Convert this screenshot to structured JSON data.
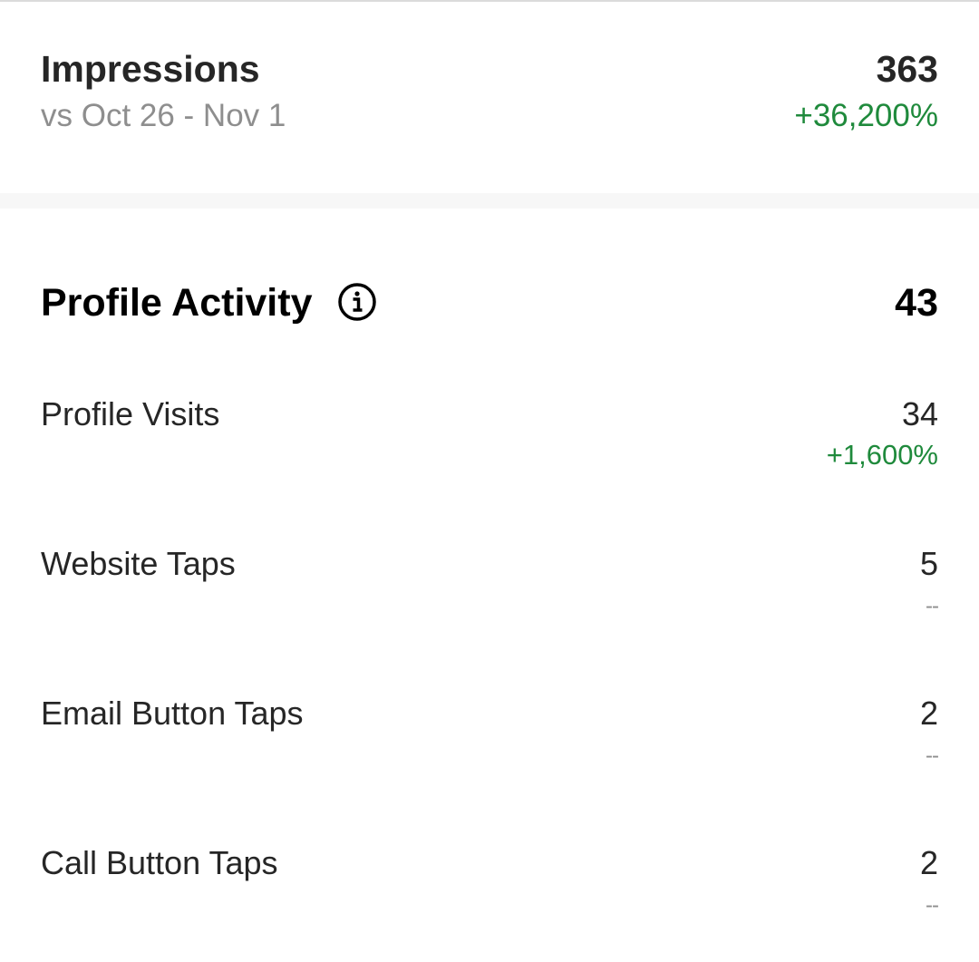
{
  "impressions": {
    "title": "Impressions",
    "comparison": "vs Oct 26 - Nov 1",
    "value": "363",
    "change": "+36,200%"
  },
  "profile_activity": {
    "title": "Profile Activity",
    "info_icon": "info-circle-icon",
    "value": "43",
    "metrics": [
      {
        "label": "Profile Visits",
        "value": "34",
        "change": "+1,600%"
      },
      {
        "label": "Website Taps",
        "value": "5",
        "change": "--"
      },
      {
        "label": "Email Button Taps",
        "value": "2",
        "change": "--"
      },
      {
        "label": "Call Button Taps",
        "value": "2",
        "change": "--"
      }
    ]
  },
  "colors": {
    "positive": "#1f8a3c",
    "muted": "#8e8e8e",
    "text": "#262626"
  }
}
